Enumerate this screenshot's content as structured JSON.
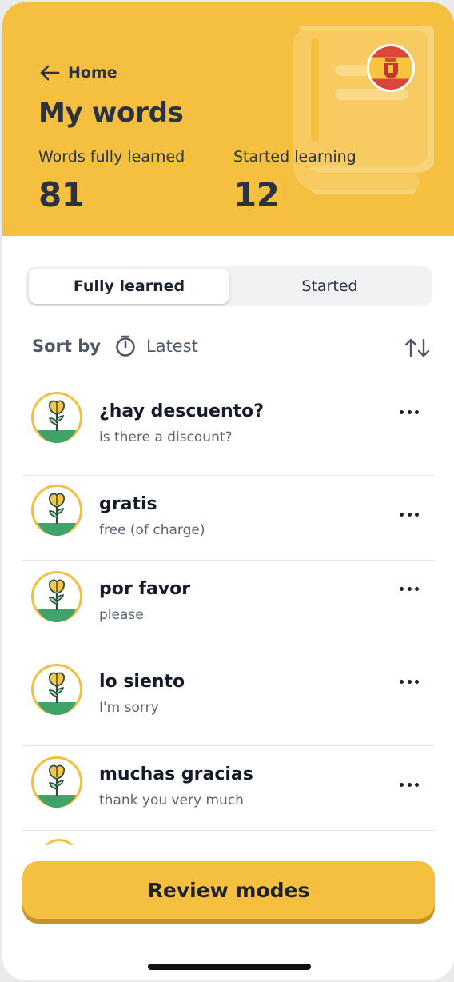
{
  "header": {
    "back_label": "Home",
    "title": "My words",
    "stats": [
      {
        "label": "Words fully learned",
        "value": "81"
      },
      {
        "label": "Started learning",
        "value": "12"
      }
    ],
    "flag_icon": "spain-flag-icon"
  },
  "tabs": [
    {
      "label": "Fully learned",
      "selected": true
    },
    {
      "label": "Started",
      "selected": false
    }
  ],
  "sort": {
    "label": "Sort by",
    "value": "Latest",
    "value_icon": "stopwatch-icon",
    "toggle_icon": "sort-arrows-icon"
  },
  "words": [
    {
      "word": "¿hay descuento?",
      "translation": "is there a discount?",
      "badge_icon": "flower-badge-icon"
    },
    {
      "word": "gratis",
      "translation": "free (of charge)",
      "badge_icon": "flower-badge-icon"
    },
    {
      "word": "por favor",
      "translation": "please",
      "badge_icon": "flower-badge-icon"
    },
    {
      "word": "lo siento",
      "translation": "I'm sorry",
      "badge_icon": "flower-badge-icon"
    },
    {
      "word": "muchas gracias",
      "translation": "thank you very much",
      "badge_icon": "flower-badge-icon"
    }
  ],
  "review_button": "Review modes",
  "colors": {
    "accent": "#f5bf3f",
    "accent_shadow": "#c7922a",
    "text_dark": "#1b2230",
    "text_muted": "#5b6472",
    "badge_green": "#3fa36b"
  }
}
